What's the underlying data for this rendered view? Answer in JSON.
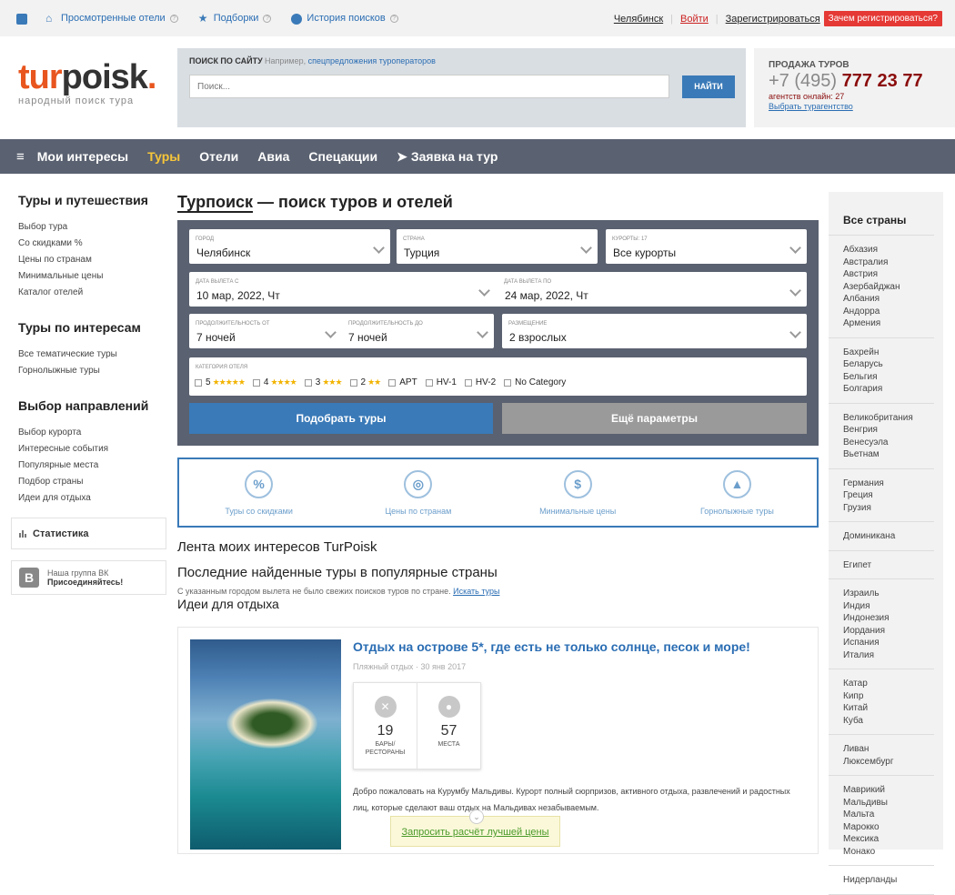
{
  "topbar": {
    "items": [
      {
        "label": "Просмотренные отели",
        "icon": "home-icon"
      },
      {
        "label": "Подборки",
        "icon": "star-icon"
      },
      {
        "label": "История поисков",
        "icon": "globe-icon"
      }
    ],
    "city": "Челябинск",
    "login": "Войти",
    "register": "Зарегистрироваться",
    "why": "Зачем регистрироваться?"
  },
  "logo": {
    "part1": "tur",
    "part2": "poisk",
    "dot": ".",
    "slogan": "народный поиск тура"
  },
  "search": {
    "label": "ПОИСК ПО САЙТУ",
    "hint_prefix": "Например,",
    "hint_link": "спецпредложения туроператоров",
    "placeholder": "Поиск...",
    "button": "НАЙТИ"
  },
  "sales": {
    "title": "ПРОДАЖА ТУРОВ",
    "code": "+7 (495)",
    "number": "777 23 77",
    "online": "агентств онлайн: 27",
    "choose": "Выбрать турагентство"
  },
  "nav": {
    "items": [
      "Мои интересы",
      "Туры",
      "Отели",
      "Авиа",
      "Спецакции"
    ],
    "request": "Заявка на тур",
    "active": "Туры"
  },
  "left": {
    "sections": [
      {
        "title": "Туры и путешествия",
        "links": [
          "Выбор тура",
          "Со скидками %",
          "Цены по странам",
          "Минимальные цены",
          "Каталог отелей"
        ]
      },
      {
        "title": "Туры по интересам",
        "links": [
          "Все тематические туры",
          "Горнолыжные туры"
        ]
      },
      {
        "title": "Выбор направлений",
        "links": [
          "Выбор курорта",
          "Интересные события",
          "Популярные места",
          "Подбор страны",
          "Идеи для отдыха"
        ]
      }
    ],
    "stats": "Статистика",
    "vk_title": "Наша группа ВК",
    "vk_join": "Присоединяйтесь!",
    "vk_letter": "B"
  },
  "main": {
    "title_link": "Турпоиск",
    "title_rest": " — поиск туров и отелей"
  },
  "form": {
    "city": {
      "label": "ГОРОД",
      "value": "Челябинск"
    },
    "country": {
      "label": "СТРАНА",
      "value": "Турция"
    },
    "resorts": {
      "label": "КУРОРТЫ: 17",
      "value": "Все курорты"
    },
    "date_from": {
      "label": "ДАТА ВЫЛЕТА С",
      "value": "10 мар, 2022, Чт"
    },
    "date_to": {
      "label": "ДАТА ВЫЛЕТА ПО",
      "value": "24 мар, 2022, Чт"
    },
    "dur_from": {
      "label": "ПРОДОЛЖИТЕЛЬНОСТЬ ОТ",
      "value": "7 ночей"
    },
    "dur_to": {
      "label": "ПРОДОЛЖИТЕЛЬНОСТЬ ДО",
      "value": "7 ночей"
    },
    "accommodation": {
      "label": "РАЗМЕЩЕНИЕ",
      "value": "2 взрослых"
    },
    "cat_label": "КАТЕГОРИЯ ОТЕЛЯ",
    "categories": [
      {
        "label": "5",
        "stars": "★★★★★"
      },
      {
        "label": "4",
        "stars": "★★★★"
      },
      {
        "label": "3",
        "stars": "★★★"
      },
      {
        "label": "2",
        "stars": "★★"
      },
      {
        "label": "APT",
        "stars": ""
      },
      {
        "label": "HV-1",
        "stars": ""
      },
      {
        "label": "HV-2",
        "stars": ""
      },
      {
        "label": "No Category",
        "stars": ""
      }
    ],
    "pick": "Подобрать туры",
    "more": "Ещё параметры"
  },
  "shortcuts": [
    {
      "label": "Туры со скидками",
      "icon": "percent-icon",
      "glyph": "%"
    },
    {
      "label": "Цены по странам",
      "icon": "globe-search-icon",
      "glyph": "◎"
    },
    {
      "label": "Минимальные цены",
      "icon": "price-tag-icon",
      "glyph": "$"
    },
    {
      "label": "Горнолыжные туры",
      "icon": "mountain-icon",
      "glyph": "▲"
    }
  ],
  "feed": {
    "h2a": "Лента моих интересов TurPoisk",
    "h2b": "Последние найденные туры в популярные страны",
    "note": "С указанным городом вылета не было свежих поисков туров по стране.",
    "note_link": "Искать туры",
    "ideas": "Идеи для отдыха"
  },
  "card": {
    "title": "Отдых на острове 5*, где есть не только солнце, песок и море!",
    "category": "Пляжный отдых",
    "date": "30 янв 2017",
    "stat1_num": "19",
    "stat1_label1": "БАРЫ/",
    "stat1_label2": "РЕСТОРАНЫ",
    "stat2_num": "57",
    "stat2_label": "МЕСТА",
    "desc": "Добро пожаловать на Курумбу Мальдивы. Курорт полный сюрпризов, активного отдыха, развлечений и радостных лиц, которые сделают ваш отдых на Мальдивах незабываемым.",
    "request": "Запросить расчёт лучшей цены"
  },
  "right": {
    "title": "Все страны",
    "groups": [
      [
        "Абхазия",
        "Австралия",
        "Австрия",
        "Азербайджан",
        "Албания",
        "Андорра",
        "Армения"
      ],
      [
        "Бахрейн",
        "Беларусь",
        "Бельгия",
        "Болгария"
      ],
      [
        "Великобритания",
        "Венгрия",
        "Венесуэла",
        "Вьетнам"
      ],
      [
        "Германия",
        "Греция",
        "Грузия"
      ],
      [
        "Доминикана"
      ],
      [
        "Египет"
      ],
      [
        "Израиль",
        "Индия",
        "Индонезия",
        "Иордания",
        "Испания",
        "Италия"
      ],
      [
        "Катар",
        "Кипр",
        "Китай",
        "Куба"
      ],
      [
        "Ливан",
        "Люксембург"
      ],
      [
        "Маврикий",
        "Мальдивы",
        "Мальта",
        "Марокко",
        "Мексика",
        "Монако"
      ],
      [
        "Нидерланды"
      ]
    ]
  },
  "colors": {
    "accent": "#3a7ab8",
    "nav_bg": "#5a6170",
    "active_nav": "#f6c63a",
    "brand_orange": "#e8551e",
    "phone": "#8b0d0d"
  }
}
